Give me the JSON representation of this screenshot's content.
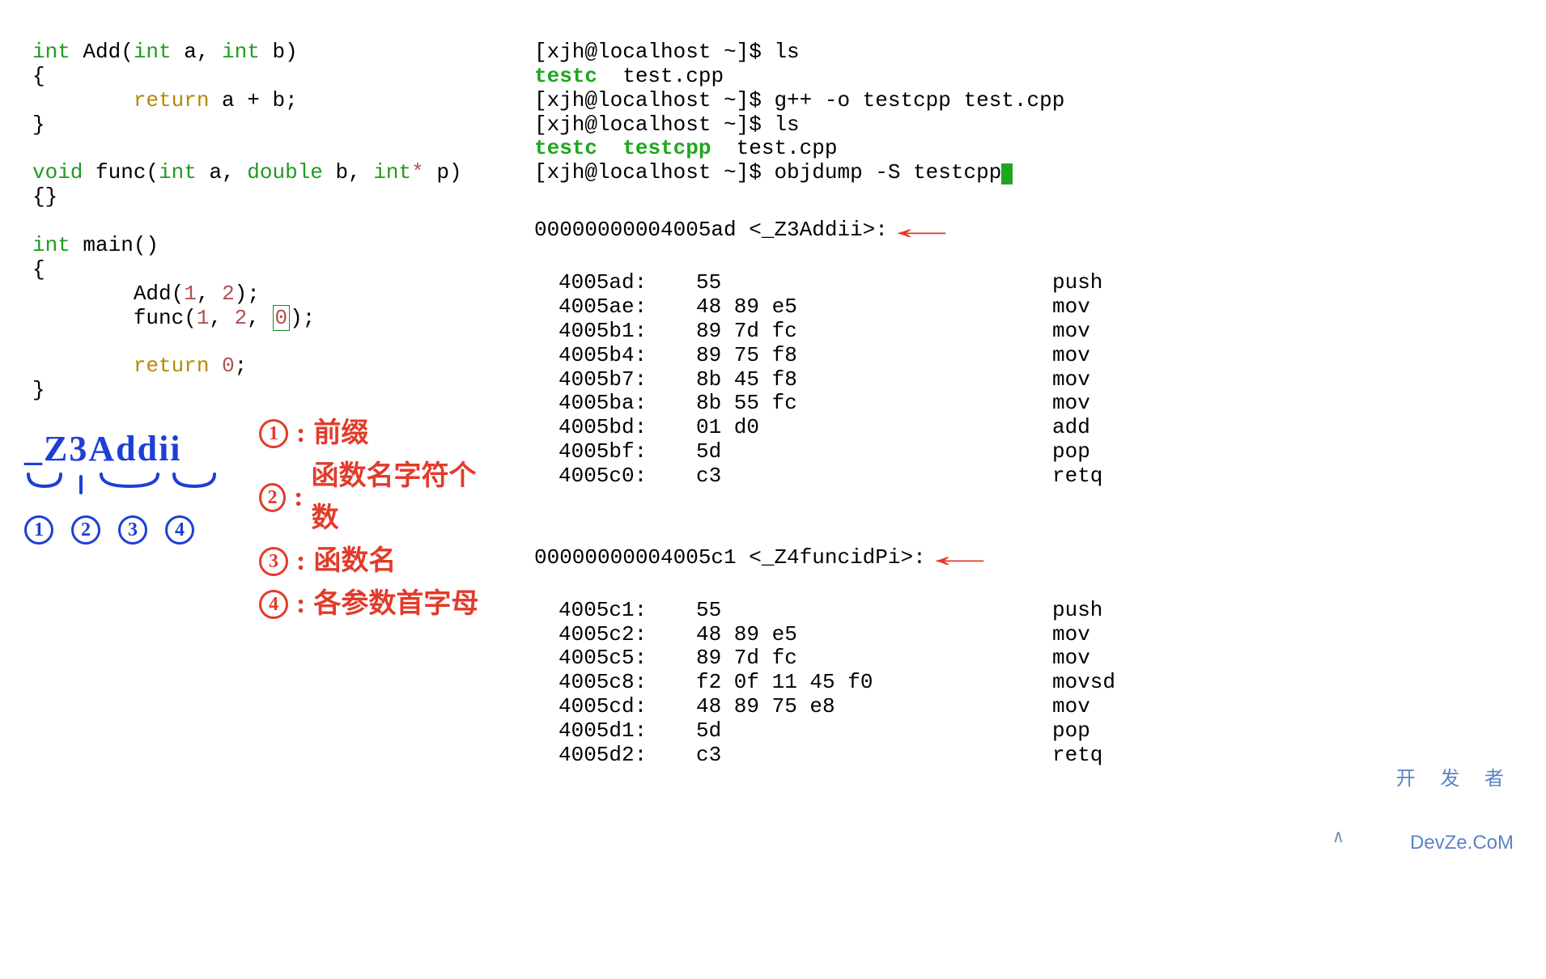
{
  "source_code": {
    "line1_type": "int",
    "line1_name": " Add(",
    "line1_p1_type": "int",
    "line1_p1_name": " a, ",
    "line1_p2_type": "int",
    "line1_p2_name": " b)",
    "line2": "{",
    "line3_ret": "return",
    "line3_expr": " a + b;",
    "line4": "}",
    "line6_type": "void",
    "line6_name": " func(",
    "line6_p1_type": "int",
    "line6_p1": " a, ",
    "line6_p2_type": "double",
    "line6_p2": " b, ",
    "line6_p3_type": "int",
    "line6_star": "*",
    "line6_p3": " p)",
    "line7": "{}",
    "line9_type": "int",
    "line9_name": " main()",
    "line10": "{",
    "line11a": "        Add(",
    "line11_n1": "1",
    "line11b": ", ",
    "line11_n2": "2",
    "line11c": ");",
    "line12a": "        func(",
    "line12_n1": "1",
    "line12b": ", ",
    "line12_n2": "2",
    "line12c": ", ",
    "line12_n3": "0",
    "line12d": ");",
    "line14_ret": "return",
    "line14_n": "0",
    "line14_semi": ";",
    "line15": "}"
  },
  "annotations": {
    "mangled": "_Z3Addii",
    "circles": [
      "①",
      "②",
      "③",
      "④"
    ],
    "legend_1": "前缀",
    "legend_2": "函数名字符个数",
    "legend_3": "函数名",
    "legend_4": "各参数首字母"
  },
  "terminal": {
    "prompt": "[xjh@localhost ~]$ ",
    "cmd_ls": "ls",
    "out1a": "testc",
    "out1b": "  test.cpp",
    "cmd_compile": "g++ -o testcpp test.cpp",
    "out2a": "testc",
    "out2b": "  ",
    "out2c": "testcpp",
    "out2d": "  test.cpp",
    "cmd_objdump": "objdump -S testcpp"
  },
  "disassembly": {
    "sym1_header": "00000000004005ad <_Z3Addii>:",
    "sym1": [
      {
        "addr": "4005ad:",
        "bytes": "55",
        "mn": "push"
      },
      {
        "addr": "4005ae:",
        "bytes": "48 89 e5",
        "mn": "mov"
      },
      {
        "addr": "4005b1:",
        "bytes": "89 7d fc",
        "mn": "mov"
      },
      {
        "addr": "4005b4:",
        "bytes": "89 75 f8",
        "mn": "mov"
      },
      {
        "addr": "4005b7:",
        "bytes": "8b 45 f8",
        "mn": "mov"
      },
      {
        "addr": "4005ba:",
        "bytes": "8b 55 fc",
        "mn": "mov"
      },
      {
        "addr": "4005bd:",
        "bytes": "01 d0",
        "mn": "add"
      },
      {
        "addr": "4005bf:",
        "bytes": "5d",
        "mn": "pop"
      },
      {
        "addr": "4005c0:",
        "bytes": "c3",
        "mn": "retq"
      }
    ],
    "sym2_header": "00000000004005c1 <_Z4funcidPi>:",
    "sym2": [
      {
        "addr": "4005c1:",
        "bytes": "55",
        "mn": "push"
      },
      {
        "addr": "4005c2:",
        "bytes": "48 89 e5",
        "mn": "mov"
      },
      {
        "addr": "4005c5:",
        "bytes": "89 7d fc",
        "mn": "mov"
      },
      {
        "addr": "4005c8:",
        "bytes": "f2 0f 11 45 f0",
        "mn": "movsd"
      },
      {
        "addr": "4005cd:",
        "bytes": "48 89 75 e8",
        "mn": "mov"
      },
      {
        "addr": "4005d1:",
        "bytes": "5d",
        "mn": "pop"
      },
      {
        "addr": "4005d2:",
        "bytes": "c3",
        "mn": "retq"
      }
    ]
  },
  "watermark": {
    "cn": "开 发 者",
    "en": "DevZe.CoM"
  }
}
